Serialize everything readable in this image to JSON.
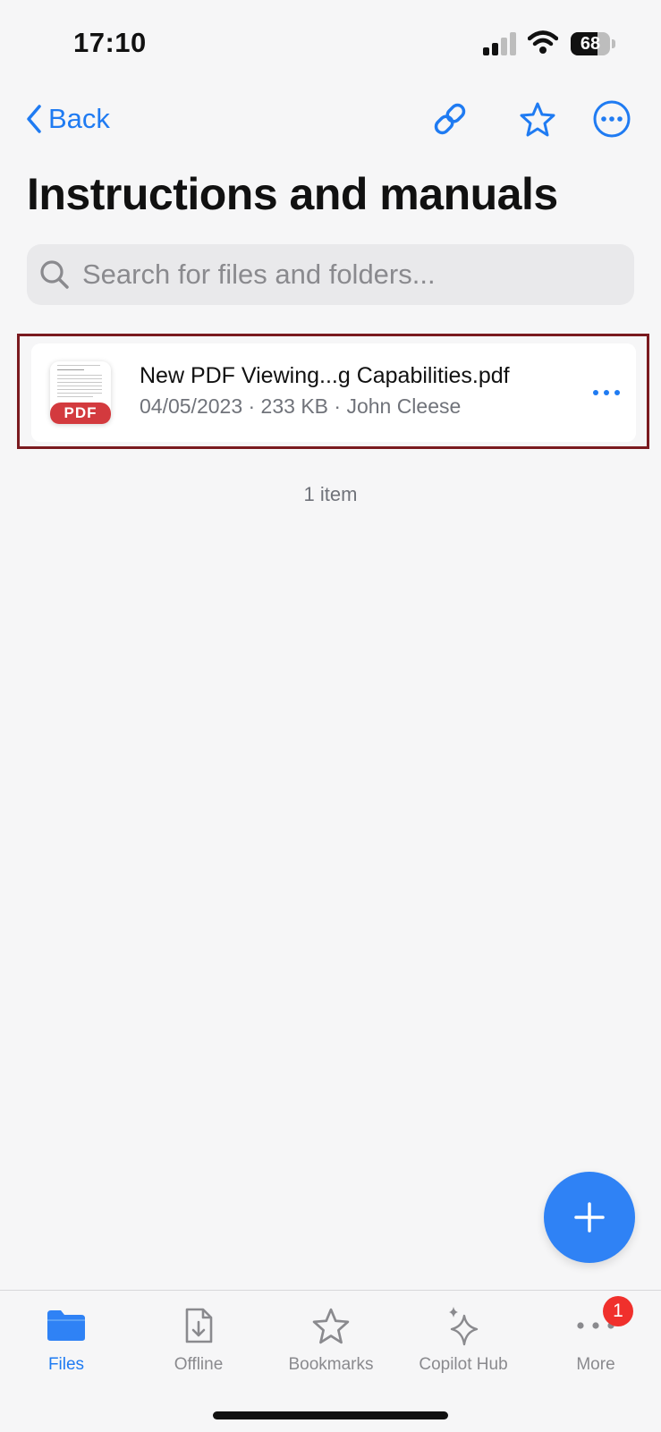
{
  "status_bar": {
    "time": "17:10",
    "battery": "68",
    "battery_level": 0.68,
    "icons": [
      "cellular-signal-icon",
      "wifi-icon",
      "battery-icon"
    ]
  },
  "nav": {
    "back_label": "Back",
    "icons": [
      "chevron-left-icon",
      "link-icon",
      "star-icon",
      "more-circle-icon"
    ]
  },
  "page": {
    "title": "Instructions and manuals"
  },
  "search": {
    "placeholder": "Search for files and folders...",
    "value": ""
  },
  "files": [
    {
      "name": "New PDF Viewing...g Capabilities.pdf",
      "meta": "04/05/2023 · 233 KB · John Cleese",
      "type_badge": "PDF"
    }
  ],
  "footer": {
    "item_count": "1 item"
  },
  "tabs": [
    {
      "label": "Files",
      "icon": "folder-icon",
      "active": true
    },
    {
      "label": "Offline",
      "icon": "offline-download-icon",
      "active": false
    },
    {
      "label": "Bookmarks",
      "icon": "star-icon",
      "active": false
    },
    {
      "label": "Copilot Hub",
      "icon": "sparkle-icon",
      "active": false
    },
    {
      "label": "More",
      "icon": "more-dots-icon",
      "active": false,
      "badge": "1"
    }
  ],
  "colors": {
    "accent": "#1f7bf2",
    "fab": "#2f82f5",
    "pdf_badge": "#d33a3e",
    "notification_badge": "#f0302c",
    "selection_outline": "#7a1a1f"
  }
}
